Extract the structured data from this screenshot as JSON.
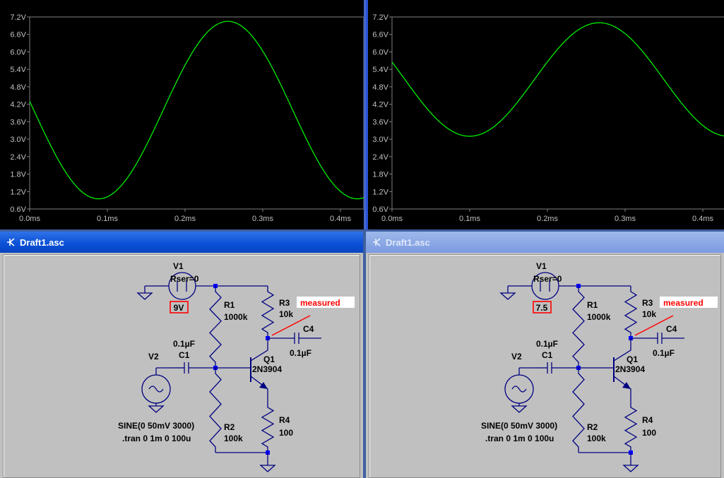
{
  "plots": [
    {
      "y_ticks": [
        "7.2V",
        "6.6V",
        "6.0V",
        "5.4V",
        "4.8V",
        "4.2V",
        "3.6V",
        "3.0V",
        "2.4V",
        "1.8V",
        "1.2V",
        "0.6V"
      ],
      "x_ticks": [
        "0.0ms",
        "0.1ms",
        "0.2ms",
        "0.3ms",
        "0.4ms"
      ],
      "trace_color": "#00ff00"
    },
    {
      "y_ticks": [
        "7.2V",
        "6.6V",
        "6.0V",
        "5.4V",
        "4.8V",
        "4.2V",
        "3.6V",
        "3.0V",
        "2.4V",
        "1.8V",
        "1.2V",
        "0.6V"
      ],
      "x_ticks": [
        "0.0ms",
        "0.1ms",
        "0.2ms",
        "0.3ms",
        "0.4ms"
      ],
      "trace_color": "#00ff00"
    }
  ],
  "chart_data": [
    {
      "type": "line",
      "x_unit": "ms",
      "y_unit": "V",
      "xlim": [
        0,
        0.43
      ],
      "ylim": [
        0.6,
        7.2
      ],
      "series": [
        {
          "offset": 4.0,
          "amplitude": 3.05,
          "period_ms": 0.3333,
          "start_value": 4.3
        }
      ]
    },
    {
      "type": "line",
      "x_unit": "ms",
      "y_unit": "V",
      "xlim": [
        0,
        0.43
      ],
      "ylim": [
        0.6,
        7.2
      ],
      "series": [
        {
          "offset": 5.05,
          "amplitude": 1.95,
          "period_ms": 0.3333,
          "start_value": 5.65
        }
      ]
    }
  ],
  "windows": [
    {
      "title": "Draft1.asc",
      "active": true,
      "labels": {
        "v1": "V1",
        "rser": "Rser=0",
        "v1_value": "9V",
        "r1": "R1",
        "r1_value": "1000k",
        "r3": "R3",
        "r3_value": "10k",
        "measured": "measured",
        "c4": "C4",
        "c4_value": "0.1µF",
        "c1_value": "0.1µF",
        "c1": "C1",
        "v2": "V2",
        "q1": "Q1",
        "q1_model": "2N3904",
        "r4": "R4",
        "r4_value": "100",
        "r2": "R2",
        "r2_value": "100k",
        "sine": "SINE(0 50mV 3000)",
        "tran": ".tran 0 1m 0 100u"
      }
    },
    {
      "title": "Draft1.asc",
      "active": false,
      "labels": {
        "v1": "V1",
        "rser": "Rser=0",
        "v1_value": "7.5",
        "r1": "R1",
        "r1_value": "1000k",
        "r3": "R3",
        "r3_value": "10k",
        "measured": "measured",
        "c4": "C4",
        "c4_value": "0.1µF",
        "c1_value": "0.1µF",
        "c1": "C1",
        "v2": "V2",
        "q1": "Q1",
        "q1_model": "2N3904",
        "r4": "R4",
        "r4_value": "100",
        "r2": "R2",
        "r2_value": "100k",
        "sine": "SINE(0 50mV 3000)",
        "tran": ".tran 0 1m 0 100u"
      }
    }
  ],
  "colors": {
    "wire": "#000080",
    "node": "#0000ff",
    "label_red": "#ff0000",
    "plot_bg": "#000000",
    "axis_label": "#c0c0c0"
  }
}
